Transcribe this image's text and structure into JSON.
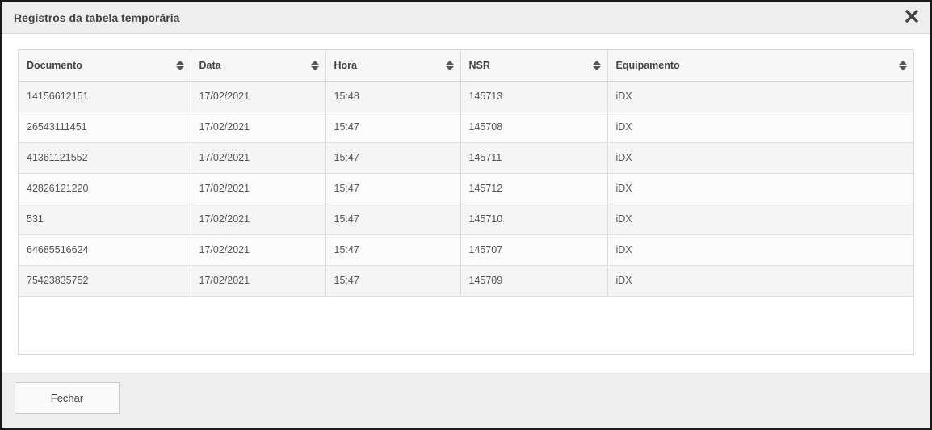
{
  "dialog": {
    "title": "Registros da tabela temporária",
    "close_icon": "close-icon"
  },
  "table": {
    "columns": [
      {
        "label": "Documento",
        "sort_icon": "sort-icon"
      },
      {
        "label": "Data",
        "sort_icon": "sort-icon"
      },
      {
        "label": "Hora",
        "sort_icon": "sort-icon"
      },
      {
        "label": "NSR",
        "sort_icon": "sort-icon"
      },
      {
        "label": "Equipamento",
        "sort_icon": "sort-icon"
      }
    ],
    "rows": [
      [
        "14156612151",
        "17/02/2021",
        "15:48",
        "145713",
        "iDX"
      ],
      [
        "26543111451",
        "17/02/2021",
        "15:47",
        "145708",
        "iDX"
      ],
      [
        "41361121552",
        "17/02/2021",
        "15:47",
        "145711",
        "iDX"
      ],
      [
        "42826121220",
        "17/02/2021",
        "15:47",
        "145712",
        "iDX"
      ],
      [
        "531",
        "17/02/2021",
        "15:47",
        "145710",
        "iDX"
      ],
      [
        "64685516624",
        "17/02/2021",
        "15:47",
        "145707",
        "iDX"
      ],
      [
        "75423835752",
        "17/02/2021",
        "15:47",
        "145709",
        "iDX"
      ]
    ]
  },
  "footer": {
    "close_button_label": "Fechar"
  },
  "colors": {
    "header_bg": "#eeeeee",
    "row_odd": "#f5f5f5",
    "row_even": "#fbfbfb",
    "text": "#555555"
  }
}
